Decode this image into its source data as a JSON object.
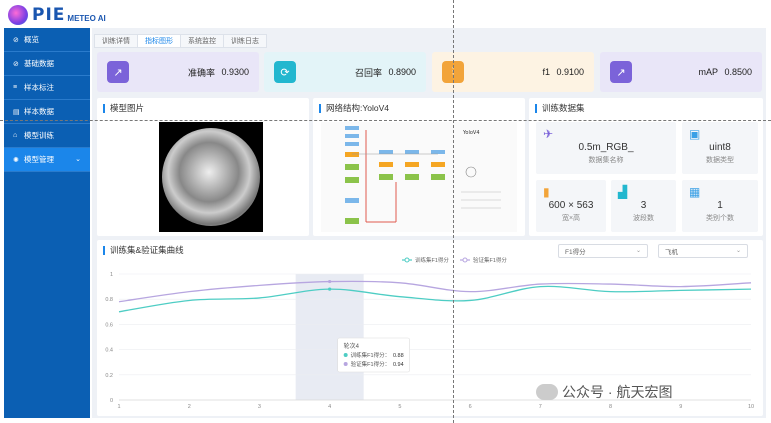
{
  "brand": {
    "name": "PIE",
    "sub": "METEO AI"
  },
  "sidebar": {
    "items": [
      {
        "label": "概览",
        "icon": "link-icon"
      },
      {
        "label": "基础数据",
        "icon": "link-icon"
      },
      {
        "label": "样本标注",
        "icon": "tag-icon"
      },
      {
        "label": "样本数据",
        "icon": "book-icon"
      },
      {
        "label": "模型训练",
        "icon": "lock-icon"
      },
      {
        "label": "模型管理",
        "icon": "gear-icon",
        "active": true
      }
    ]
  },
  "tabs": [
    {
      "label": "训练详情"
    },
    {
      "label": "指标图形",
      "active": true
    },
    {
      "label": "系统监控"
    },
    {
      "label": "训练日志"
    }
  ],
  "kpis": [
    {
      "label": "准确率",
      "value": "0.9300",
      "color": "#7b63d9",
      "bg": "#e9e6f8",
      "icon": "trend-icon"
    },
    {
      "label": "召回率",
      "value": "0.8900",
      "color": "#22b7cf",
      "bg": "#e3f4f8",
      "icon": "refresh-icon"
    },
    {
      "label": "f1",
      "value": "0.9100",
      "color": "#f2a43a",
      "bg": "#fdf3e3",
      "icon": "bars-icon"
    },
    {
      "label": "mAP",
      "value": "0.8500",
      "color": "#7b63d9",
      "bg": "#e9e6f8",
      "icon": "trend-icon"
    }
  ],
  "panels": {
    "model_image": "模型图片",
    "network": "网络结构:YoloV4",
    "dataset": "训练数据集",
    "curve": "训练集&验证集曲线"
  },
  "dataset": {
    "cards": [
      {
        "value": "0.5m_RGB_",
        "label": "数据集名称",
        "icon": "plane-icon",
        "color": "#7b63d9"
      },
      {
        "value": "uint8",
        "label": "数据类型",
        "icon": "image-icon",
        "color": "#3aa0e6"
      },
      {
        "value": "600 × 563",
        "label": "宽×高",
        "icon": "chart-icon",
        "color": "#f2a43a"
      },
      {
        "value": "3",
        "label": "波段数",
        "icon": "layers-icon",
        "color": "#22b7cf"
      },
      {
        "value": "1",
        "label": "类别个数",
        "icon": "grid-icon",
        "color": "#3aa0e6"
      }
    ]
  },
  "selects": {
    "metric": "F1得分",
    "class": "飞机"
  },
  "chart_data": {
    "type": "line",
    "x": [
      1,
      2,
      3,
      4,
      5,
      6,
      7,
      8,
      9,
      10
    ],
    "series": [
      {
        "name": "训练集F1得分",
        "color": "#4ecdc4",
        "values": [
          0.7,
          0.79,
          0.81,
          0.88,
          0.82,
          0.79,
          0.9,
          0.86,
          0.87,
          0.88
        ]
      },
      {
        "name": "验证集F1得分",
        "color": "#b7a6e0",
        "values": [
          0.78,
          0.86,
          0.91,
          0.94,
          0.93,
          0.86,
          0.92,
          0.92,
          0.9,
          0.93
        ]
      }
    ],
    "ylim": [
      0,
      1
    ],
    "yticks": [
      "0",
      "0.2",
      "0.4",
      "0.6",
      "0.8",
      "1"
    ],
    "legend": "top-center",
    "tooltip": {
      "title": "轮次4",
      "rows": [
        {
          "label": "训练集F1得分：",
          "value": "0.88"
        },
        {
          "label": "验证集F1得分：",
          "value": "0.94"
        }
      ]
    }
  },
  "watermark": "公众号 · 航天宏图"
}
